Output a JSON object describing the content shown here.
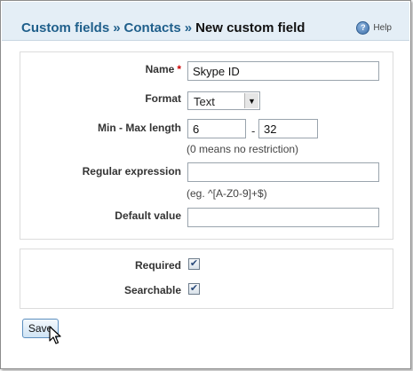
{
  "header": {
    "breadcrumb": [
      "Custom fields",
      "Contacts",
      "New custom field"
    ],
    "separator": "»",
    "help_label": "Help",
    "help_icon": "help-icon"
  },
  "form": {
    "name": {
      "label": "Name",
      "required_marker": "*",
      "value": "Skype ID"
    },
    "format": {
      "label": "Format",
      "selected": "Text"
    },
    "length": {
      "label": "Min - Max length",
      "min": "6",
      "separator": "-",
      "max": "32",
      "hint": "(0 means no restriction)"
    },
    "regex": {
      "label": "Regular expression",
      "value": "",
      "hint": "(eg. ^[A-Z0-9]+$)"
    },
    "default_value": {
      "label": "Default value",
      "value": ""
    }
  },
  "flags": {
    "required": {
      "label": "Required",
      "checked": true
    },
    "searchable": {
      "label": "Searchable",
      "checked": true
    }
  },
  "actions": {
    "save_label": "Save"
  },
  "colors": {
    "header_bg": "#e4eef6",
    "link": "#1f5f8b",
    "required": "#cc0000"
  }
}
